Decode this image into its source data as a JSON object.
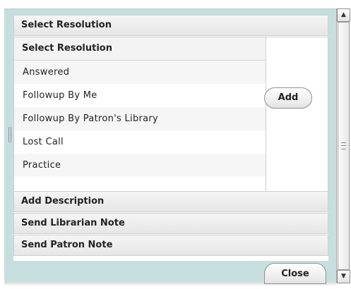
{
  "dialog": {
    "header_title": "Select Resolution",
    "list": {
      "header": "Select Resolution",
      "items": [
        {
          "label": "Answered"
        },
        {
          "label": "Followup By Me"
        },
        {
          "label": "Followup By Patron's Library"
        },
        {
          "label": "Lost Call"
        },
        {
          "label": "Practice"
        }
      ]
    },
    "add_label": "Add",
    "sections": [
      {
        "label": "Add Description"
      },
      {
        "label": "Send Librarian Note"
      },
      {
        "label": "Send Patron Note"
      }
    ],
    "close_label": "Close"
  },
  "scrollbar": {
    "up_glyph": "▲",
    "down_glyph": "▼"
  },
  "colors": {
    "dialog_background": "#c7dedf",
    "section_header": "#eeeeee"
  }
}
